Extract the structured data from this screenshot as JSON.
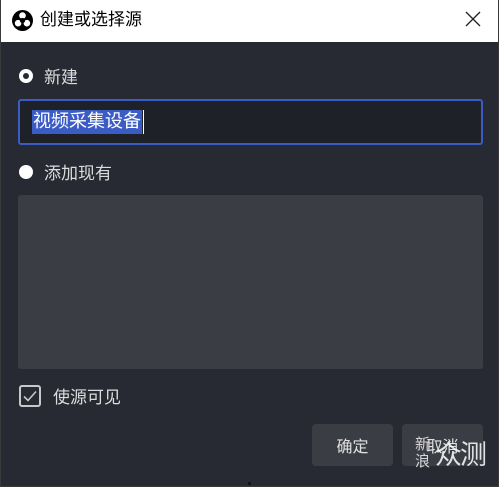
{
  "window": {
    "title": "创建或选择源",
    "close_icon": "close-icon",
    "app_icon": "obs-logo-icon"
  },
  "options": {
    "new_label": "新建",
    "new_selected": true,
    "existing_label": "添加现有",
    "existing_selected": false
  },
  "name_input": {
    "value": "视频采集设备"
  },
  "existing_sources": [],
  "visible_checkbox": {
    "label": "使源可见",
    "checked": true
  },
  "buttons": {
    "ok_label": "确定",
    "cancel_label": "取消"
  },
  "watermark": {
    "left": "新浪",
    "right": "众测"
  },
  "colors": {
    "background": "#272a33",
    "accent": "#3b5cc4",
    "button": "#3b3d45"
  }
}
